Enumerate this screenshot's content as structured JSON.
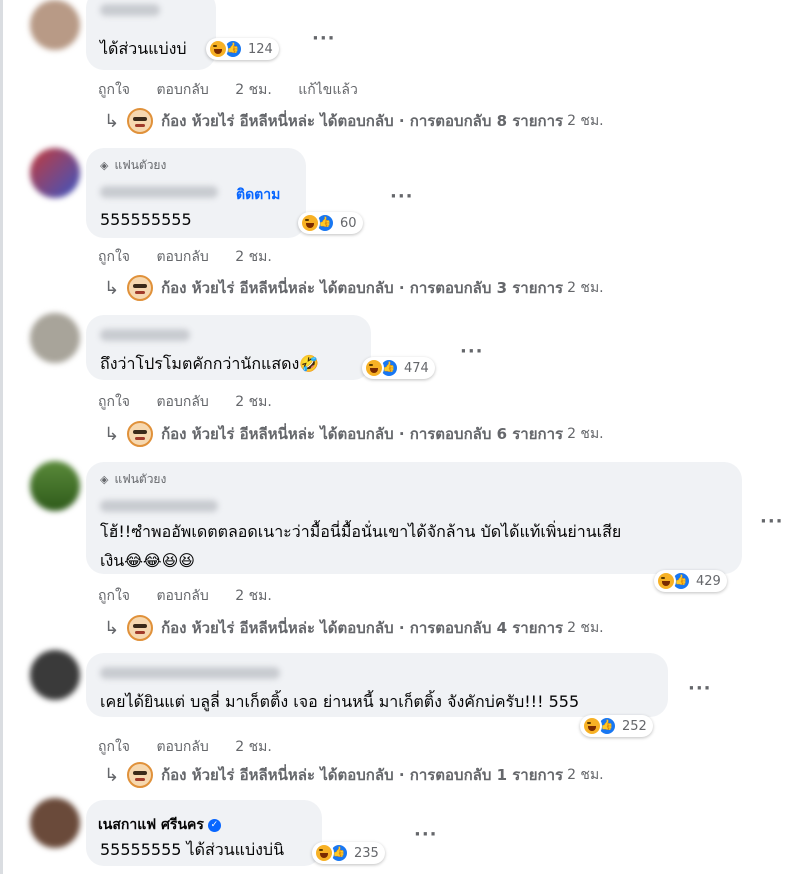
{
  "colors": {
    "accent": "#0866ff",
    "bubble": "#f0f2f5",
    "secondary_text": "#65676b",
    "haha": "#f7b125",
    "like": "#1877f2"
  },
  "labels": {
    "like": "ถูกใจ",
    "reply": "ตอบกลับ",
    "edited": "แก้ไขแล้ว",
    "fan_badge": "แฟนตัวยง",
    "follow": "ติดตาม"
  },
  "comments": [
    {
      "text": "ได้ส่วนแบ่งบ่",
      "reaction_count": "124",
      "time": "2 ชม.",
      "reply": {
        "summary": "ก้อง ห้วยไร่ อีหลีหนี่หล่ะ ได้ตอบกลับ · การตอบกลับ 8 รายการ",
        "time": "2 ชม."
      }
    },
    {
      "text": "555555555",
      "reaction_count": "60",
      "time": "2 ชม.",
      "reply": {
        "summary": "ก้อง ห้วยไร่ อีหลีหนี่หล่ะ ได้ตอบกลับ · การตอบกลับ 3 รายการ",
        "time": "2 ชม."
      }
    },
    {
      "text": "ถึงว่าโปรโมตคักกว่านักแสดง🤣",
      "reaction_count": "474",
      "time": "2 ชม.",
      "reply": {
        "summary": "ก้อง ห้วยไร่ อีหลีหนี่หล่ะ ได้ตอบกลับ · การตอบกลับ 6 รายการ",
        "time": "2 ชม."
      }
    },
    {
      "text_line1": "โฮ้!!ซำพออัพเดตตลอดเนาะว่ามื้อนี่มื้อนั่นเขาได้จักล้าน บัดได้แท้เพิ่นย่านเสีย",
      "text_line2": "เงิน😂😂😆😆",
      "reaction_count": "429",
      "time": "2 ชม.",
      "reply": {
        "summary": "ก้อง ห้วยไร่ อีหลีหนี่หล่ะ ได้ตอบกลับ · การตอบกลับ 4 รายการ",
        "time": "2 ชม."
      }
    },
    {
      "text": "เคยได้ยินแต่ บลูลี่ มาเก็ตติ้ง เจอ ย่านหนี้ มาเก็ตติ้ง จังคักบ่ครับ!!! 555",
      "reaction_count": "252",
      "time": "2 ชม.",
      "reply": {
        "summary": "ก้อง ห้วยไร่ อีหลีหนี่หล่ะ ได้ตอบกลับ · การตอบกลับ 1 รายการ",
        "time": "2 ชม."
      }
    },
    {
      "author": "เนสกาแฟ ศรีนคร",
      "text": "55555555 ได้ส่วนแบ่งบ่นิ",
      "reaction_count": "235"
    }
  ]
}
